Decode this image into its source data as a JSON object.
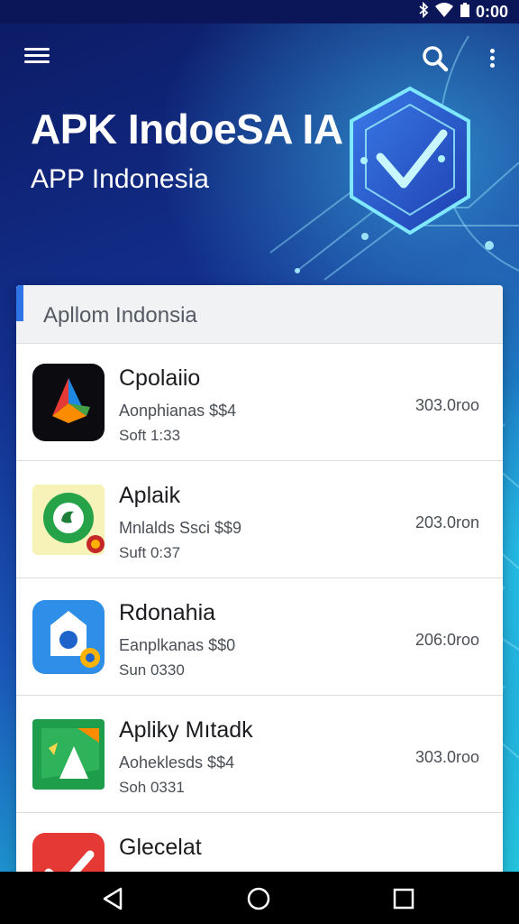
{
  "status_bar": {
    "time": "0:00",
    "icons": [
      "bluetooth-icon",
      "wifi-icon",
      "battery-icon"
    ]
  },
  "app_bar": {
    "title": "APK IndoeSA IA",
    "subtitle": "APP Indonesia",
    "icons": [
      "menu-icon",
      "search-icon",
      "more-vert-icon"
    ]
  },
  "list": {
    "header": "Apllom Indonsia",
    "items": [
      {
        "name": "Cpolaiio",
        "meta1": "Aonphianas $$4",
        "meta2": "Soft 1:33",
        "size": "303.0roo",
        "icon": "pinwheel-app-icon"
      },
      {
        "name": "Aplaik",
        "meta1": "Mnlalds Ssci $$9",
        "meta2": "Suft 0:37",
        "size": "203.0ron",
        "icon": "green-ring-app-icon"
      },
      {
        "name": "Rdonahia",
        "meta1": "Eanplkanas $$0",
        "meta2": "Sun 0330",
        "size": "206:0roo",
        "icon": "blue-camera-app-icon"
      },
      {
        "name": "Apliky Mıtadk",
        "meta1": "Aoheklesds $$4",
        "meta2": "Soh 0331",
        "size": "303.0roo",
        "icon": "green-map-app-icon"
      },
      {
        "name": "Glecelat",
        "meta1": "",
        "meta2": "",
        "size": "",
        "icon": "red-check-app-icon"
      }
    ]
  },
  "nav_bar": {
    "icons": [
      "back-icon",
      "home-icon",
      "recents-icon"
    ]
  },
  "colors": {
    "accent": "#2f74e6",
    "background_dark": "#0c1a63",
    "background_light": "#27d0e0",
    "card": "#ffffff"
  }
}
